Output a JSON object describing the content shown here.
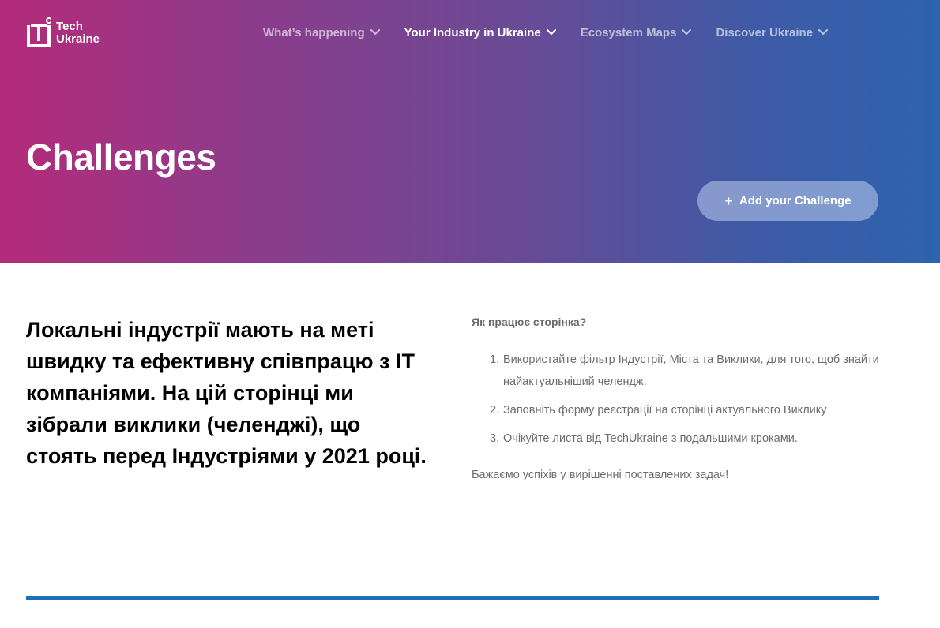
{
  "brand": {
    "line1": "Tech",
    "line2": "Ukraine"
  },
  "nav": {
    "items": [
      {
        "label": "What’s happening"
      },
      {
        "label": "Your Industry in Ukraine"
      },
      {
        "label": "Ecosystem Maps"
      },
      {
        "label": "Discover Ukraine"
      }
    ],
    "active_index": 1
  },
  "hero": {
    "title": "Challenges",
    "add_button": "Add your Challenge"
  },
  "intro": {
    "text": "Локальні індустрії мають на меті швидку та ефективну співпрацю з IT компаніями. На цій сторінці ми зібрали виклики (челенджі), що стоять перед Індустріями у 2021 році."
  },
  "howto": {
    "title": "Як працює сторінка?",
    "steps": [
      {
        "num": "1.",
        "text": "Використайте фільтр Індустрії, Міста та Виклики, для того, щоб знайти найактуальніший челендж."
      },
      {
        "num": "2.",
        "text": "Заповніть форму реєстрації на сторінці актуального Виклику"
      },
      {
        "num": "3.",
        "text": "Очікуйте листа від TechUkraine з подальшими кроками."
      }
    ],
    "wish": "Бажаємо успіхів у вирішенні поставлених задач!"
  },
  "colors": {
    "hero_gradient_start": "#b42b7a",
    "hero_gradient_end": "#2e63ae",
    "divider": "#1e6fb3"
  }
}
